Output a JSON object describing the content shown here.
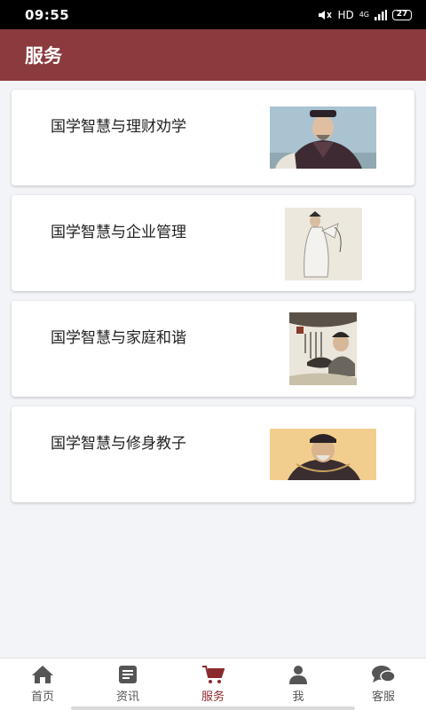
{
  "status_bar": {
    "time": "09:55",
    "network": "HD",
    "signal_type": "4G",
    "battery": "27"
  },
  "header": {
    "title": "服务"
  },
  "services": [
    {
      "title": "国学智慧与理财劝学",
      "image": "portrait-official-seated"
    },
    {
      "title": "国学智慧与企业管理",
      "image": "portrait-scholar-white-robe"
    },
    {
      "title": "国学智慧与家庭和谐",
      "image": "portrait-elder-calligraphy"
    },
    {
      "title": "国学智慧与修身教子",
      "image": "portrait-elder-official-hat"
    }
  ],
  "bottom_nav": [
    {
      "label": "首页",
      "icon": "home-icon",
      "active": false
    },
    {
      "label": "资讯",
      "icon": "news-icon",
      "active": false
    },
    {
      "label": "服务",
      "icon": "cart-icon",
      "active": true
    },
    {
      "label": "我",
      "icon": "user-icon",
      "active": false
    },
    {
      "label": "客服",
      "icon": "chat-icon",
      "active": false
    }
  ],
  "colors": {
    "accent": "#8b3a3d",
    "active_nav": "#8b2a2e",
    "background": "#f3f4f8"
  }
}
